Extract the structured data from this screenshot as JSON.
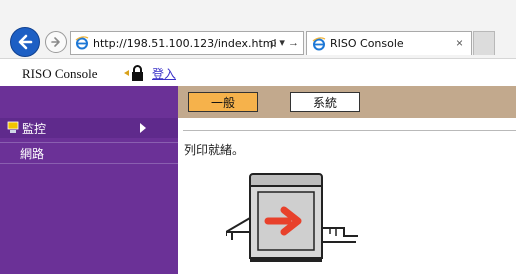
{
  "browser": {
    "url": "http://198.51.100.123/index.html",
    "address_tools": "ρ ▾ →",
    "tab_title": "RISO Console",
    "tab_close": "×"
  },
  "header": {
    "brand": "RISO Console",
    "login_label": "登入"
  },
  "sidebar": {
    "items": [
      {
        "label": "監控",
        "selected": true
      },
      {
        "label": "網路",
        "selected": false
      }
    ]
  },
  "main": {
    "tabs": [
      {
        "label": "一般",
        "active": true
      },
      {
        "label": "系統",
        "active": false
      }
    ],
    "status_text": "列印就緒。"
  },
  "colors": {
    "sidebar": "#6b3197",
    "tab_bar": "#c2a98d",
    "active_tab": "#f6b24b",
    "arrow": "#e8412b"
  },
  "icons": [
    "back-arrow-icon",
    "forward-arrow-icon",
    "ie-logo-icon",
    "lock-icon",
    "monitor-icon",
    "printer-icon"
  ]
}
